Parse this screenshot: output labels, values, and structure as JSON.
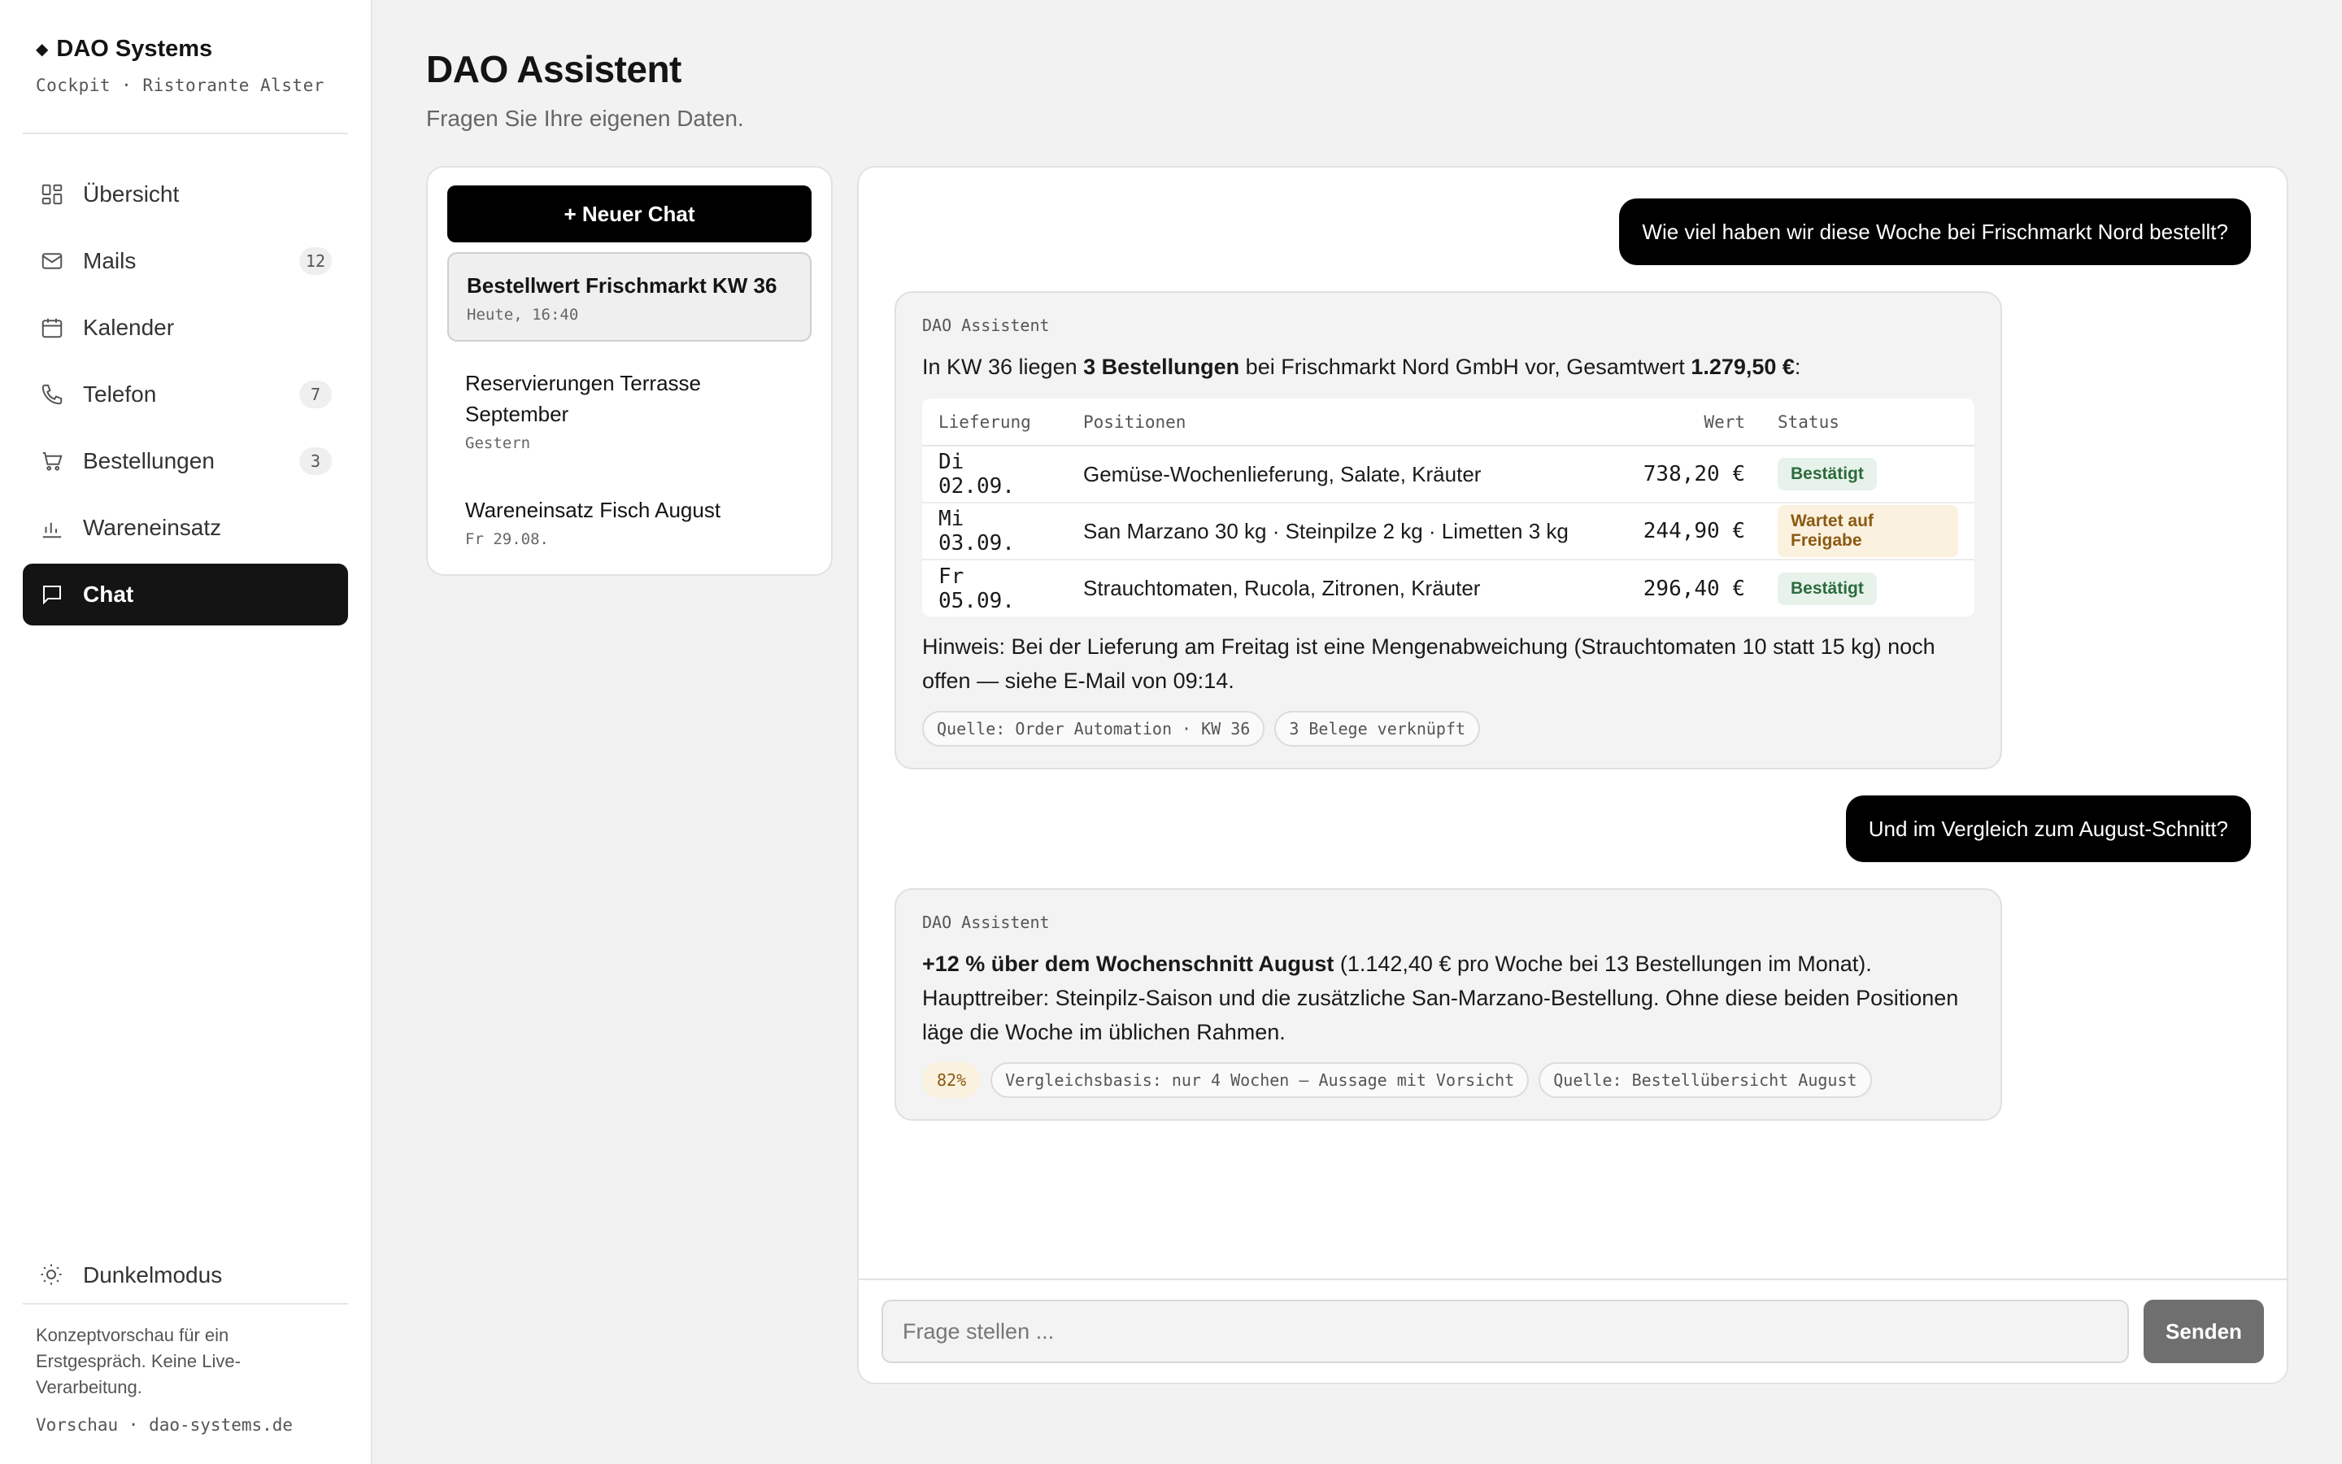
{
  "brand": {
    "symbol": "◆",
    "title": "DAO Systems",
    "subtitle": "Cockpit · Ristorante Alster"
  },
  "nav": [
    {
      "label": "Übersicht",
      "badge": "",
      "icon": "grid-icon"
    },
    {
      "label": "Mails",
      "badge": "12",
      "icon": "mail-icon"
    },
    {
      "label": "Kalender",
      "badge": "",
      "icon": "calendar-icon"
    },
    {
      "label": "Telefon",
      "badge": "7",
      "icon": "phone-icon"
    },
    {
      "label": "Bestellungen",
      "badge": "3",
      "icon": "cart-icon"
    },
    {
      "label": "Wareneinsatz",
      "badge": "",
      "icon": "bar-chart-icon"
    },
    {
      "label": "Chat",
      "badge": "",
      "icon": "chat-icon",
      "active": true
    }
  ],
  "sidebar_footer": {
    "darkmode_label": "Dunkelmodus",
    "note": "Konzeptvorschau für ein Erstgespräch. Keine Live-Verarbeitung.",
    "link": "Vorschau · dao-systems.de"
  },
  "page": {
    "title": "DAO Assistent",
    "subtitle": "Fragen Sie Ihre eigenen Daten."
  },
  "chat_list": {
    "new_chat_label": "+ Neuer Chat",
    "items": [
      {
        "title": "Bestellwert Frischmarkt KW 36",
        "date": "Heute, 16:40"
      },
      {
        "title": "Reservierungen Terrasse September",
        "date": "Gestern"
      },
      {
        "title": "Wareneinsatz Fisch August",
        "date": "Fr 29.08."
      }
    ]
  },
  "conversation": {
    "user_1": "Wie viel haben wir diese Woche bei Frischmarkt Nord bestellt?",
    "bot_1": {
      "name": "DAO Assistent",
      "intro_a": "In KW 36 liegen ",
      "intro_b": "3 Bestellungen",
      "intro_c": " bei Frischmarkt Nord GmbH vor, Gesamtwert ",
      "intro_d": "1.279,50 €",
      "intro_e": ":",
      "table": {
        "headers": [
          "Lieferung",
          "Positionen",
          "Wert",
          "Status"
        ],
        "rows": [
          {
            "date": "Di 02.09.",
            "items": "Gemüse-Wochenlieferung, Salate, Kräuter",
            "value": "738,20 €",
            "status": "Bestätigt"
          },
          {
            "date": "Mi 03.09.",
            "items": "San Marzano 30 kg · Steinpilze 2 kg · Limetten 3 kg",
            "value": "244,90 €",
            "status": "Wartet auf Freigabe"
          },
          {
            "date": "Fr 05.09.",
            "items": "Strauchtomaten, Rucola, Zitronen, Kräuter",
            "value": "296,40 €",
            "status": "Bestätigt"
          }
        ]
      },
      "note": "Hinweis: Bei der Lieferung am Freitag ist eine Mengenabweichung (Strauchtomaten 10 statt 15 kg) noch offen — siehe E-Mail von 09:14.",
      "chips": [
        "Quelle: Order Automation · KW 36",
        "3 Belege verknüpft"
      ]
    },
    "user_2": "Und im Vergleich zum August-Schnitt?",
    "bot_2": {
      "name": "DAO Assistent",
      "text_bold": "+12 % über dem Wochenschnitt August",
      "text_rest": " (1.142,40 € pro Woche bei 13 Bestellungen im Monat). Haupttreiber: Steinpilz-Saison und die zusätzliche San-Marzano-Bestellung. Ohne diese beiden Positionen läge die Woche im üblichen Rahmen.",
      "confidence": "82%",
      "chips": [
        "Vergleichsbasis: nur 4 Wochen — Aussage mit Vorsicht",
        "Quelle: Bestellübersicht August"
      ]
    }
  },
  "composer": {
    "placeholder": "Frage stellen ...",
    "send_label": "Senden"
  }
}
